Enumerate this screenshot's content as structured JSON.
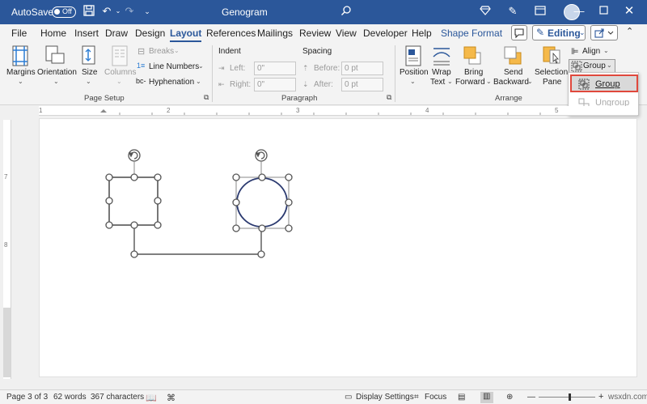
{
  "titlebar": {
    "autosave_label": "AutoSave",
    "autosave_state": "Off",
    "doc_title": "Genogram"
  },
  "menu": {
    "items": [
      "File",
      "Home",
      "Insert",
      "Draw",
      "Design",
      "Layout",
      "References",
      "Mailings",
      "Review",
      "View",
      "Developer",
      "Help",
      "Shape Format"
    ],
    "active": "Layout",
    "editing_label": "Editing"
  },
  "ribbon": {
    "page_setup": {
      "margins": "Margins",
      "orientation": "Orientation",
      "size": "Size",
      "columns": "Columns",
      "breaks": "Breaks",
      "line_numbers": "Line Numbers",
      "hyphenation": "Hyphenation",
      "group_label": "Page Setup"
    },
    "paragraph": {
      "indent": "Indent",
      "spacing": "Spacing",
      "left_label": "Left:",
      "left_value": "0\"",
      "right_label": "Right:",
      "right_value": "0\"",
      "before_label": "Before:",
      "before_value": "0 pt",
      "after_label": "After:",
      "after_value": "0 pt",
      "group_label": "Paragraph"
    },
    "arrange": {
      "position": "Position",
      "wrap1": "Wrap",
      "wrap2": "Text",
      "bring1": "Bring",
      "bring2": "Forward",
      "send1": "Send",
      "send2": "Backward",
      "sel1": "Selection",
      "sel2": "Pane",
      "align": "Align",
      "group": "Group",
      "group_label": "Arrange"
    }
  },
  "dropdown": {
    "group": "Group",
    "ungroup": "Ungroup"
  },
  "ruler": {
    "h_marks": [
      "1",
      "2",
      "3",
      "4",
      "5"
    ],
    "v_marks": [
      "7",
      "8"
    ]
  },
  "statusbar": {
    "page": "Page 3 of 3",
    "words": "62 words",
    "chars": "367 characters",
    "display_settings": "Display Settings",
    "focus": "Focus",
    "watermark": "wsxdn.com"
  },
  "colors": {
    "title_bar": "#2b579a",
    "highlight": "#e0483c",
    "shape_stroke": "#555555",
    "circle_stroke": "#2b3a70"
  }
}
